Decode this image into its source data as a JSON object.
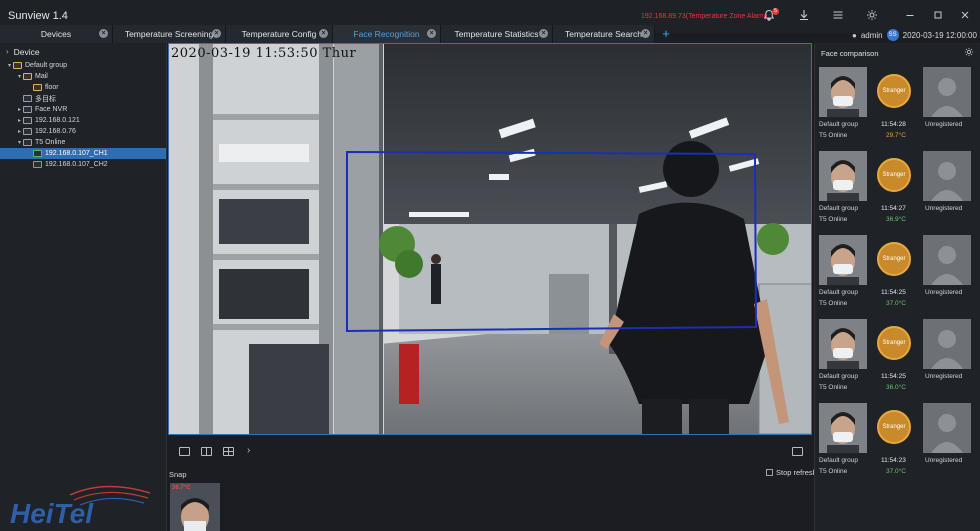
{
  "app": {
    "title": "Sunview 1.4"
  },
  "alarm": {
    "text": "192.168.89.73(Temperature Zone Alarm)",
    "count": "5"
  },
  "user": {
    "name": "admin",
    "avatar": "SS",
    "datetime": "2020-03-19 12:00:00"
  },
  "tabs": [
    {
      "label": "Devices",
      "active": false
    },
    {
      "label": "Temperature Screening",
      "active": false
    },
    {
      "label": "Temperature Config",
      "active": false
    },
    {
      "label": "Face Recognition",
      "active": true
    },
    {
      "label": "Temperature Statistics",
      "active": false
    },
    {
      "label": "Temperature Search",
      "active": false
    }
  ],
  "sidebar": {
    "header": "Device",
    "items": [
      {
        "label": "Default group",
        "depth": 0,
        "arrow": "▾",
        "icon": "group"
      },
      {
        "label": "Mail",
        "depth": 1,
        "arrow": "▾",
        "icon": "group"
      },
      {
        "label": "floor",
        "depth": 2,
        "arrow": "",
        "icon": "group"
      },
      {
        "label": "多目标",
        "depth": 1,
        "arrow": "",
        "icon": "device"
      },
      {
        "label": "Face NVR",
        "depth": 1,
        "arrow": "▸",
        "icon": "device"
      },
      {
        "label": "192.168.0.121",
        "depth": 1,
        "arrow": "▸",
        "icon": "device"
      },
      {
        "label": "192.168.0.76",
        "depth": 1,
        "arrow": "▸",
        "icon": "device"
      },
      {
        "label": "T5 Online",
        "depth": 1,
        "arrow": "▾",
        "icon": "device"
      },
      {
        "label": "192.168.0.107_CH1",
        "depth": 2,
        "arrow": "",
        "icon": "cam",
        "selected": true
      },
      {
        "label": "192.168.0.107_CH2",
        "depth": 2,
        "arrow": "",
        "icon": "cam"
      }
    ]
  },
  "video": {
    "osd": "2020-03-19 11:53:50 Thur"
  },
  "snap": {
    "label": "Snap",
    "stop_refresh": "Stop refresh",
    "temp": "36.7°C"
  },
  "face_comparison": {
    "title": "Face comparison",
    "rows": [
      {
        "group": "Default group",
        "device": "T5 Online",
        "status": "Stranger",
        "time": "11:54:28",
        "temp": "29.7°C",
        "temp_state": "hot",
        "result": "Unregistered"
      },
      {
        "group": "Default group",
        "device": "T5 Online",
        "status": "Stranger",
        "time": "11:54:27",
        "temp": "36.9°C",
        "temp_state": "ok",
        "result": "Unregistered"
      },
      {
        "group": "Default group",
        "device": "T5 Online",
        "status": "Stranger",
        "time": "11:54:25",
        "temp": "37.0°C",
        "temp_state": "ok",
        "result": "Unregistered"
      },
      {
        "group": "Default group",
        "device": "T5 Online",
        "status": "Stranger",
        "time": "11:54:25",
        "temp": "36.0°C",
        "temp_state": "ok",
        "result": "Unregistered"
      },
      {
        "group": "Default group",
        "device": "T5 Online",
        "status": "Stranger",
        "time": "11:54:23",
        "temp": "37.0°C",
        "temp_state": "ok",
        "result": "Unregistered"
      }
    ]
  },
  "logo": {
    "text": "HeiTel"
  },
  "colors": {
    "accent": "#4aa3e8",
    "alarm": "#e23a3a",
    "badge": "#c98a2c",
    "ok_temp": "#6cc56f",
    "hot_temp": "#e8a23c"
  }
}
